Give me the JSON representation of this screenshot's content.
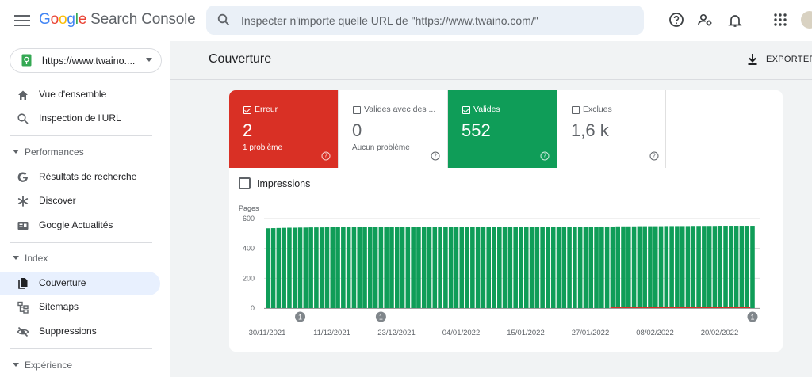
{
  "header": {
    "logo_letters": [
      "G",
      "o",
      "o",
      "g",
      "l",
      "e"
    ],
    "logo_rest": "Search Console",
    "search_placeholder": "Inspecter n'importe quelle URL de \"https://www.twaino.com/\"",
    "icons": [
      "menu-icon",
      "search-icon",
      "help-icon",
      "manage-users-icon",
      "notifications-icon",
      "apps-icon",
      "avatar"
    ]
  },
  "sidebar": {
    "property": "https://www.twaino....",
    "top_items": [
      {
        "label": "Vue d'ensemble",
        "icon": "home-icon"
      },
      {
        "label": "Inspection de l'URL",
        "icon": "search-icon"
      }
    ],
    "sections": [
      {
        "label": "Performances",
        "items": [
          {
            "label": "Résultats de recherche",
            "icon": "google-g-icon"
          },
          {
            "label": "Discover",
            "icon": "asterisk-icon"
          },
          {
            "label": "Google Actualités",
            "icon": "news-icon"
          }
        ]
      },
      {
        "label": "Index",
        "items": [
          {
            "label": "Couverture",
            "icon": "file-copy-icon",
            "active": true
          },
          {
            "label": "Sitemaps",
            "icon": "sitemap-icon"
          },
          {
            "label": "Suppressions",
            "icon": "visibility-off-icon"
          }
        ]
      },
      {
        "label": "Expérience",
        "items": []
      }
    ]
  },
  "main": {
    "title": "Couverture",
    "export_label": "EXPORTER",
    "tiles": [
      {
        "label": "Erreur",
        "value": "2",
        "sub": "1 problème",
        "checked": true,
        "kind": "err"
      },
      {
        "label": "Valides avec des ...",
        "value": "0",
        "sub": "Aucun problème",
        "checked": false,
        "kind": "plain"
      },
      {
        "label": "Valides",
        "value": "552",
        "sub": "",
        "checked": true,
        "kind": "valid"
      },
      {
        "label": "Exclues",
        "value": "1,6 k",
        "sub": "",
        "checked": false,
        "kind": "plain"
      }
    ],
    "impressions_label": "Impressions"
  },
  "colors": {
    "error": "#d93025",
    "valid": "#0f9d58",
    "accent_bg": "#e8f0fe"
  },
  "chart_data": {
    "type": "bar",
    "ylabel": "Pages",
    "ylim": [
      0,
      600
    ],
    "yticks": [
      0,
      200,
      400,
      600
    ],
    "x_tick_labels": [
      "30/11/2021",
      "11/12/2021",
      "23/12/2021",
      "04/01/2022",
      "15/01/2022",
      "27/01/2022",
      "08/02/2022",
      "20/02/2022"
    ],
    "annotation_label": "1",
    "annotations_at": [
      6,
      21,
      90
    ],
    "start_label": "30/11/2021",
    "num_bars": 91,
    "series": [
      {
        "name": "Valides",
        "color": "#0f9d58",
        "values": [
          535,
          536,
          537,
          538,
          539,
          539,
          540,
          540,
          541,
          541,
          541,
          542,
          542,
          542,
          543,
          543,
          543,
          543,
          544,
          544,
          544,
          544,
          545,
          545,
          545,
          545,
          545,
          545,
          545,
          545,
          544,
          544,
          543,
          543,
          543,
          543,
          544,
          544,
          544,
          544,
          543,
          543,
          543,
          543,
          543,
          543,
          543,
          544,
          544,
          544,
          544,
          544,
          545,
          545,
          545,
          545,
          545,
          545,
          546,
          546,
          546,
          546,
          547,
          547,
          547,
          548,
          548,
          548,
          548,
          549,
          549,
          549,
          549,
          549,
          550,
          550,
          550,
          550,
          550,
          551,
          551,
          551,
          551,
          551,
          552,
          552,
          552,
          552,
          552,
          552,
          552
        ]
      },
      {
        "name": "Erreur",
        "color": "#d93025",
        "values": [
          0,
          0,
          0,
          0,
          0,
          0,
          0,
          0,
          0,
          0,
          0,
          0,
          0,
          0,
          0,
          0,
          0,
          0,
          0,
          0,
          0,
          0,
          0,
          0,
          0,
          0,
          0,
          0,
          0,
          0,
          0,
          0,
          0,
          0,
          0,
          0,
          0,
          0,
          0,
          0,
          0,
          0,
          0,
          0,
          0,
          0,
          0,
          0,
          0,
          0,
          0,
          0,
          0,
          0,
          0,
          0,
          0,
          0,
          0,
          0,
          0,
          0,
          0,
          0,
          2,
          2,
          2,
          2,
          2,
          2,
          2,
          2,
          2,
          2,
          2,
          2,
          2,
          2,
          2,
          2,
          2,
          2,
          2,
          2,
          2,
          2,
          2,
          2,
          2,
          2,
          0
        ]
      }
    ]
  }
}
